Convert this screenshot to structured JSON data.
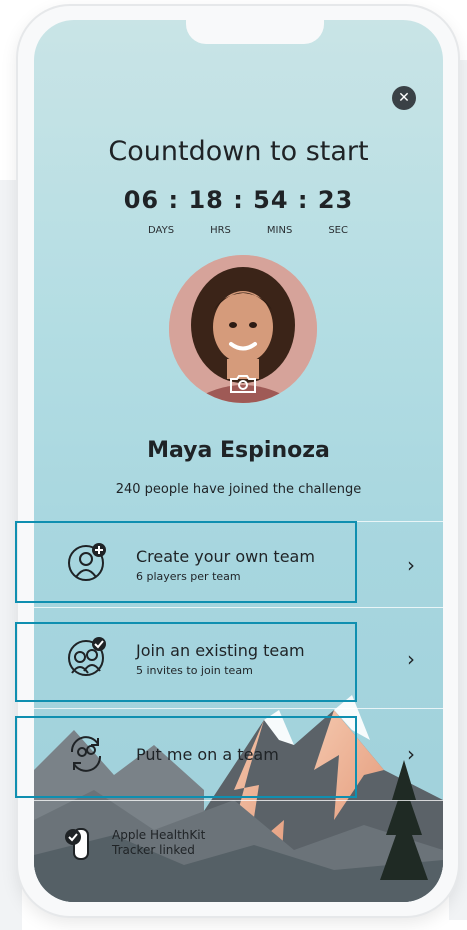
{
  "challenge": {
    "title": "Countdown to start",
    "countdown": "06 : 18 : 54 : 23",
    "units": [
      "DAYS",
      "HRS",
      "MINS",
      "SEC"
    ]
  },
  "user": {
    "name": "Maya Espinoza",
    "joined_text": "240 people have joined the challenge"
  },
  "options": [
    {
      "title": "Create your own team",
      "subtitle": "6 players per team",
      "icon": "create-team-icon"
    },
    {
      "title": "Join an existing team",
      "subtitle": "5 invites to join team",
      "icon": "join-team-icon"
    },
    {
      "title": "Put me on a team",
      "subtitle": "",
      "icon": "auto-assign-team-icon"
    }
  ],
  "tracker": {
    "line1": "Apple HealthKit",
    "line2": "Tracker linked"
  },
  "colors": {
    "accent_highlight": "#0f8fb0",
    "text": "#1f2326",
    "close_button": "#3a4146"
  }
}
